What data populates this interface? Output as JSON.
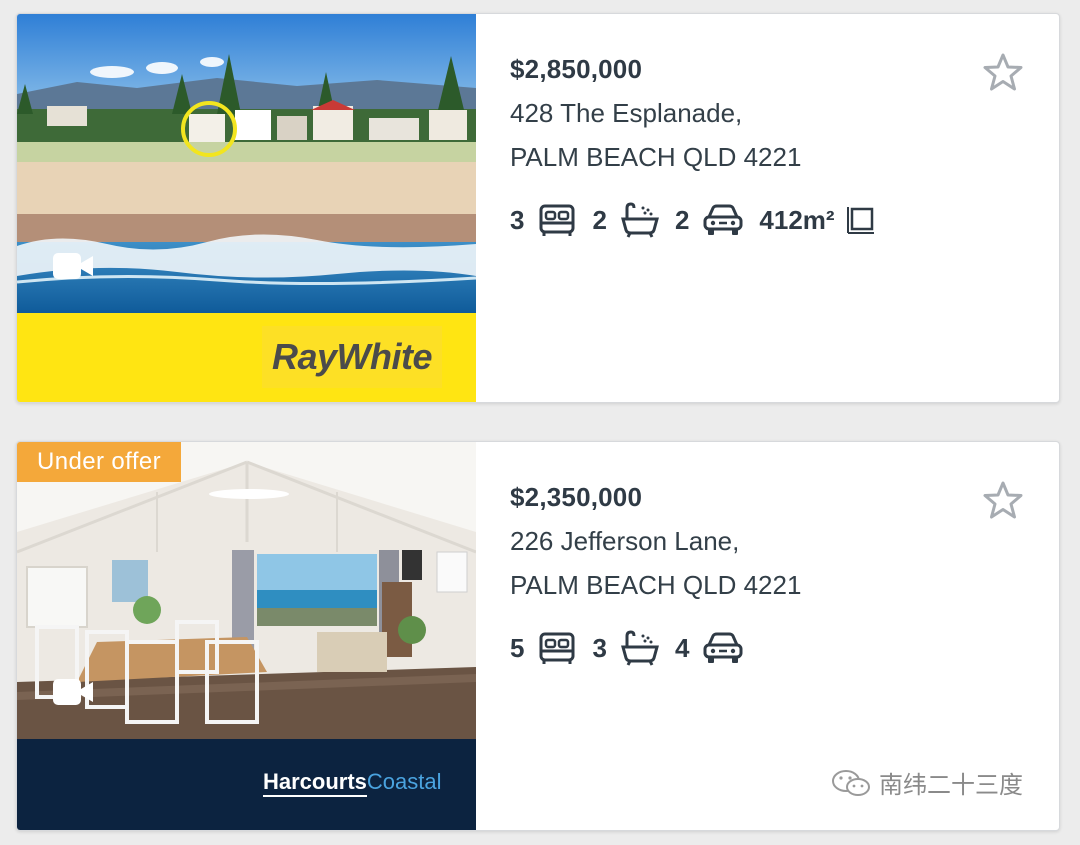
{
  "listings": [
    {
      "price": "$2,850,000",
      "address_line1": "428 The Esplanade,",
      "address_line2": "PALM BEACH QLD 4221",
      "bedrooms": "3",
      "bathrooms": "2",
      "parking": "2",
      "land_size": "412m²",
      "agency": "RayWhite",
      "agency_color": "#ffe512",
      "has_video": true,
      "icons": {
        "bed": "bed-icon",
        "bath": "bath-icon",
        "car": "car-icon",
        "land": "land-size-icon",
        "favourite": "star-icon",
        "video": "video-icon"
      }
    },
    {
      "badge": "Under offer",
      "price": "$2,350,000",
      "address_line1": "226 Jefferson Lane,",
      "address_line2": "PALM BEACH QLD 4221",
      "bedrooms": "5",
      "bathrooms": "3",
      "parking": "4",
      "agency_part1": "Harcourts",
      "agency_part2": "Coastal",
      "agency_color": "#0c2340",
      "badge_color": "#f4a83a",
      "has_video": true,
      "icons": {
        "bed": "bed-icon",
        "bath": "bath-icon",
        "car": "car-icon",
        "favourite": "star-icon",
        "video": "video-icon"
      }
    }
  ],
  "watermark": "南纬二十三度"
}
